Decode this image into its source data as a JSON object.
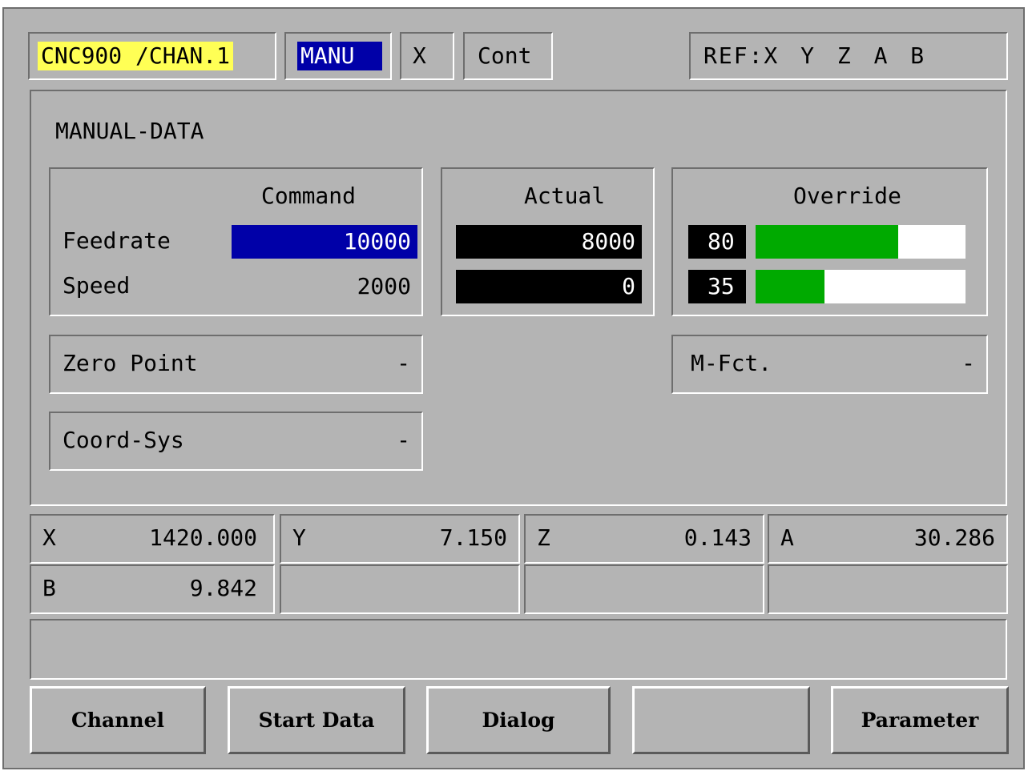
{
  "header": {
    "channel": "CNC900 /CHAN.1",
    "mode": "MANU",
    "axis": "X",
    "cont": "Cont",
    "ref": "REF:X Y Z A B"
  },
  "panel": {
    "title": "MANUAL-DATA",
    "command_header": "Command",
    "actual_header": "Actual",
    "override_header": "Override",
    "feedrate_label": "Feedrate",
    "speed_label": "Speed",
    "feedrate_command": "10000",
    "speed_command": "2000",
    "feedrate_actual": "8000",
    "speed_actual": "0",
    "feed_override": "80",
    "speed_override": "35",
    "feed_override_fraction": 0.68,
    "speed_override_fraction": 0.33,
    "zero_point_label": "Zero Point",
    "zero_point_value": "-",
    "coord_sys_label": "Coord-Sys",
    "coord_sys_value": "-",
    "m_fct_label": "M-Fct.",
    "m_fct_value": "-"
  },
  "axes": [
    {
      "name": "X",
      "value": "1420.000"
    },
    {
      "name": "Y",
      "value": "7.150"
    },
    {
      "name": "Z",
      "value": "0.143"
    },
    {
      "name": "A",
      "value": "30.286"
    },
    {
      "name": "B",
      "value": "9.842"
    }
  ],
  "softkeys": [
    "Channel",
    "Start Data",
    "Dialog",
    "",
    "Parameter"
  ],
  "colors": {
    "background": "#b4b4b4",
    "channel_highlight": "#ffff55",
    "mode_highlight": "#0000a8",
    "command_field": "#0000a8",
    "actual_field": "#000000",
    "override_bar": "#00aa00"
  }
}
